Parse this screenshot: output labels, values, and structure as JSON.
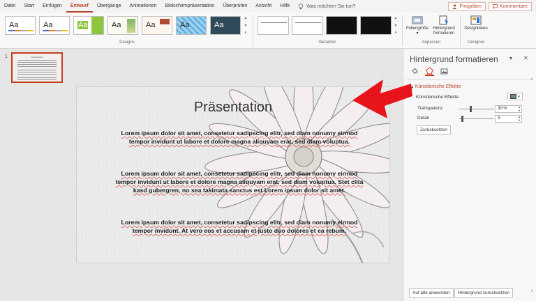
{
  "tabs": [
    "Datei",
    "Start",
    "Einfügen",
    "Entwurf",
    "Übergänge",
    "Animationen",
    "Bildschirmpräsentation",
    "Überprüfen",
    "Ansicht",
    "Hilfe"
  ],
  "active_tab_index": 3,
  "tell_me": "Was möchten Sie tun?",
  "share_label": "Freigeben",
  "comments_label": "Kommentare",
  "ribbon": {
    "theme_glyph": "Aa",
    "designs_label": "Designs",
    "variants_label": "Varianten",
    "slide_size_label_1": "Foliengröße",
    "format_bg_label_1": "Hintergrund",
    "format_bg_label_2": "formatieren",
    "customize_label": "Anpassen",
    "designer_ideas_label": "Designideen",
    "designer_label": "Designer"
  },
  "thumbnails": {
    "slide_number": "1"
  },
  "slide": {
    "title": "Präsentation",
    "paragraphs": [
      "Lorem ipsum dolor sit amet, consetetur sadipscing elitr, sed diam nonumy eirmod tempor invidunt ut labore et dolore magna aliquyam erat, sed diam voluptua.",
      "Lorem ipsum dolor sit amet, consetetur sadipscing elitr, sed diam nonumy eirmod tempor invidunt ut labore et dolore magna aliquyam erat, sed diam voluptua. Stet clita kasd gubergren, no sea takimata sanctus est Lorem ipsum dolor sit amet.",
      "Lorem ipsum dolor sit amet, consetetur sadipscing elitr, sed diam nonumy eirmod tempor invidunt. At vero eos et accusam et justo duo dolores et ea rebum."
    ]
  },
  "pane": {
    "title": "Hintergrund formatieren",
    "section": "Künstlerische Effekte",
    "effects_label": "Künstlerische Effekte",
    "transparency_label": "Transparenz",
    "transparency_value": "30 %",
    "detail_label": "Detail",
    "detail_value": "3",
    "reset_label": "Zurücksetzen",
    "apply_all_label": "Auf alle anwenden",
    "reset_bg_label": "Hintergrund zurücksetzen"
  },
  "colors": {
    "accent": "#b7472a",
    "arrow": "#e8141b"
  }
}
